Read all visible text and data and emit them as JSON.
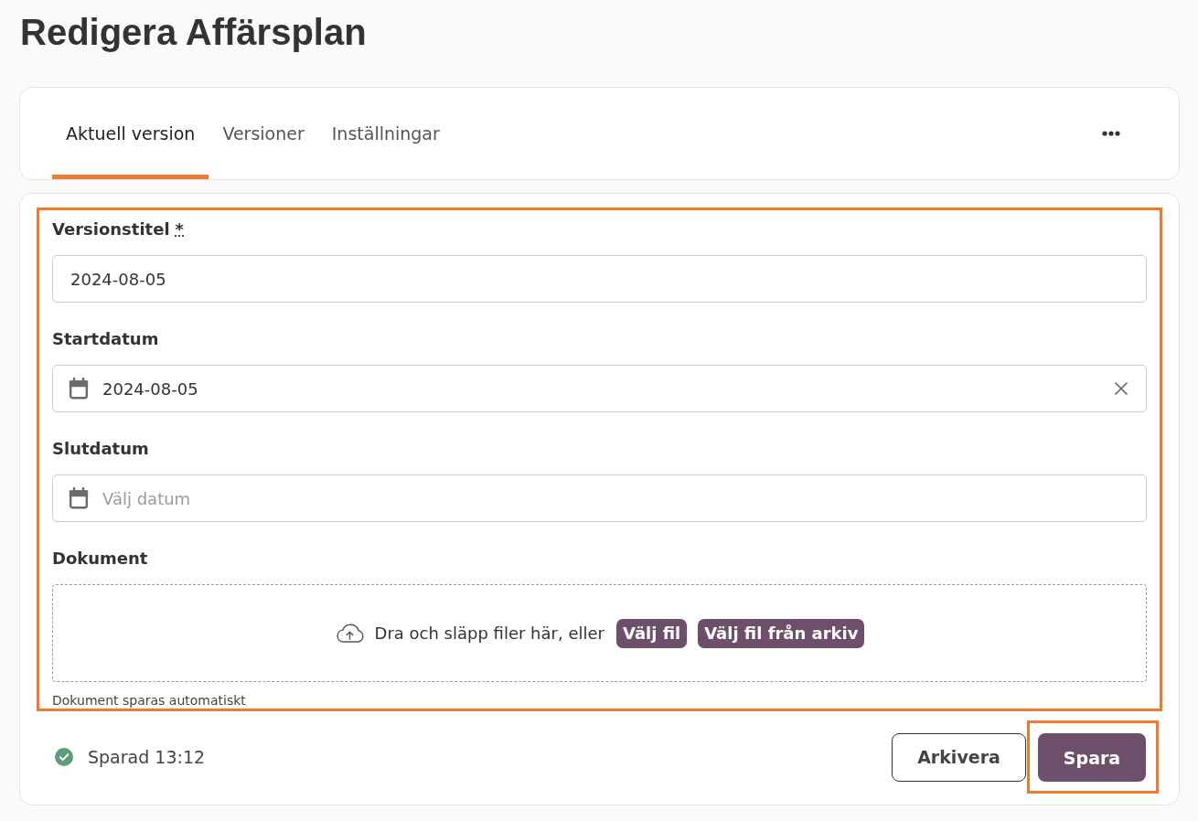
{
  "page": {
    "title": "Redigera Affärsplan"
  },
  "tabs": [
    {
      "label": "Aktuell version",
      "selected": true
    },
    {
      "label": "Versioner",
      "selected": false
    },
    {
      "label": "Inställningar",
      "selected": false
    }
  ],
  "form": {
    "highlighted": true,
    "fields": [
      {
        "kind": "text",
        "label": "Versionstitel",
        "required_mark": "*",
        "value": "2024-08-05"
      },
      {
        "kind": "date",
        "label": "Startdatum",
        "value": "2024-08-05",
        "clearable": true
      },
      {
        "kind": "date",
        "label": "Slutdatum",
        "placeholder": "Välj datum",
        "clearable": false
      },
      {
        "kind": "file",
        "label": "Dokument",
        "drop_text": "Dra och släpp filer här, eller",
        "buttons": [
          "Välj fil",
          "Välj fil från arkiv"
        ],
        "help": "Dokument sparas automatiskt"
      }
    ]
  },
  "footer": {
    "status": {
      "text": "Sparad 13:12",
      "saved": true
    },
    "buttons": [
      {
        "label": "Arkivera",
        "kind": "secondary",
        "highlighted": false
      },
      {
        "label": "Spara",
        "kind": "primary",
        "highlighted": true
      }
    ]
  }
}
